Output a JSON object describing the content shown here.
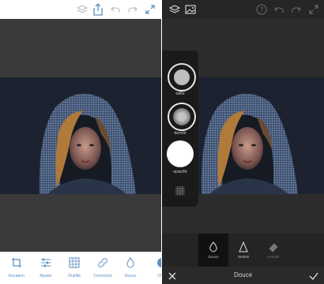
{
  "left_screen": {
    "toolbar": {
      "tools": [
        {
          "label": "Recadrer",
          "icon": "crop-icon"
        },
        {
          "label": "Ajuster",
          "icon": "sliders-icon"
        },
        {
          "label": "Fluidité",
          "icon": "grid-warp-icon"
        },
        {
          "label": "Correcteur",
          "icon": "bandage-icon"
        },
        {
          "label": "Douce",
          "icon": "drop-icon"
        },
        {
          "label": "Cl",
          "icon": "partial-tool-icon"
        }
      ]
    },
    "header_icons": [
      "layers-icon",
      "share-icon",
      "undo-icon",
      "redo-icon",
      "expand-icon"
    ]
  },
  "right_screen": {
    "header_icons": [
      "layers-icon",
      "image-icon",
      "help-icon",
      "undo-icon",
      "redo-icon",
      "expand-icon"
    ],
    "brush_panel": {
      "size_label": "taille",
      "hardness_label": "dureté",
      "opacity_label": "opacité"
    },
    "brush_types": [
      {
        "label": "Douce",
        "icon": "drop-icon",
        "selected": true
      },
      {
        "label": "Netteté",
        "icon": "triangle-icon",
        "selected": false
      },
      {
        "label": "Annuler",
        "icon": "eraser-icon",
        "selected": false
      }
    ],
    "bottom_bar": {
      "title": "Douce",
      "cancel_icon": "close-icon",
      "confirm_icon": "check-icon"
    }
  },
  "colors": {
    "accent_blue": "#5d8fbf",
    "photo_background": "#1e2430",
    "dark_canvas": "#2c2c2c"
  }
}
